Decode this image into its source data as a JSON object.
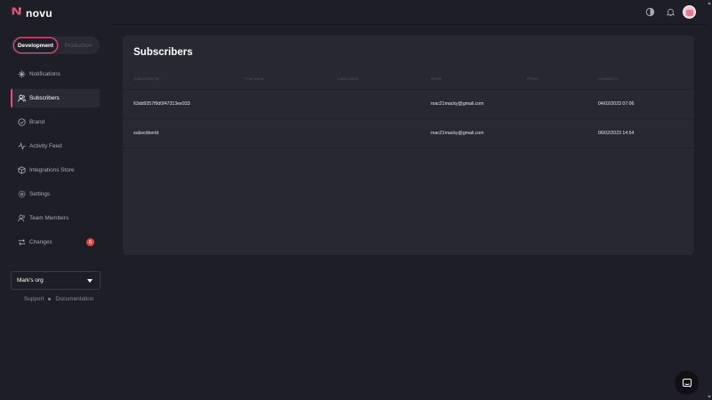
{
  "brand": {
    "name": "novu",
    "accent": "#e84e79"
  },
  "header": {
    "icons": [
      "theme-toggle-icon",
      "bell-icon",
      "avatar"
    ]
  },
  "sidebar": {
    "environments": [
      {
        "label": "Development",
        "active": true
      },
      {
        "label": "Production",
        "active": false
      }
    ],
    "items": [
      {
        "label": "Notifications",
        "icon": "bolt-icon",
        "active": false
      },
      {
        "label": "Subscribers",
        "icon": "users-icon",
        "active": true
      },
      {
        "label": "Brand",
        "icon": "check-circle-icon",
        "active": false
      },
      {
        "label": "Activity Feed",
        "icon": "activity-icon",
        "active": false
      },
      {
        "label": "Integrations Store",
        "icon": "box-icon",
        "active": false
      },
      {
        "label": "Settings",
        "icon": "gear-icon",
        "active": false
      },
      {
        "label": "Team Members",
        "icon": "team-icon",
        "active": false
      },
      {
        "label": "Changes",
        "icon": "repeat-icon",
        "active": false,
        "badge": "6"
      }
    ],
    "org": {
      "name": "Mark's org"
    },
    "footer": {
      "support": "Support",
      "documentation": "Documentation"
    }
  },
  "main": {
    "title": "Subscribers",
    "columns": [
      "Subscriber Id",
      "First name",
      "Last name",
      "Email",
      "Phone",
      "Created At"
    ],
    "rows": [
      {
        "subscriber_id": "63dd9357f9d0f47313ee933",
        "first_name": "",
        "last_name": "",
        "email": "mac21macky@gmail.com",
        "phone": "",
        "created_at": "04/02/2023 07:06"
      },
      {
        "subscriber_id": "subscriberId",
        "first_name": "",
        "last_name": "",
        "email": "mac21macky@gmail.com",
        "phone": "",
        "created_at": "06/02/2023 14:54"
      }
    ]
  },
  "chat": {
    "icon": "chat-icon"
  }
}
